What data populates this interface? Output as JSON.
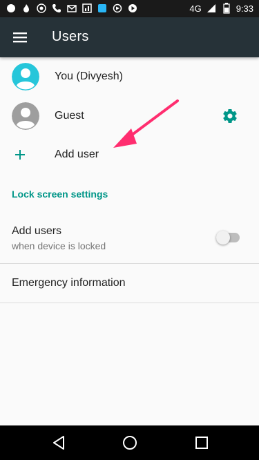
{
  "status_bar": {
    "network": "4G",
    "time": "9:33",
    "icons": [
      "notification-icon",
      "fire-icon",
      "whatsapp-icon",
      "phone-icon",
      "gmail-icon",
      "chart-icon",
      "ifh-app-icon",
      "video-icon",
      "play-icon",
      "signal-icon",
      "battery-icon"
    ]
  },
  "app_bar": {
    "title": "Users",
    "menu_icon": "hamburger-menu-icon"
  },
  "users": [
    {
      "name": "You (Divyesh)",
      "avatar_color": "#26c6da"
    },
    {
      "name": "Guest",
      "avatar_color": "#9e9e9e"
    }
  ],
  "add_user": {
    "label": "Add user"
  },
  "lock_screen": {
    "section_title": "Lock screen settings",
    "add_users_title": "Add users",
    "add_users_subtitle": "when device is locked",
    "add_users_enabled": false
  },
  "emergency": {
    "label": "Emergency information"
  },
  "colors": {
    "accent": "#009688",
    "app_bar": "#263238",
    "annotation_arrow": "#ff2d6f"
  },
  "nav": {
    "buttons": [
      "back-icon",
      "home-icon",
      "recents-icon"
    ]
  }
}
